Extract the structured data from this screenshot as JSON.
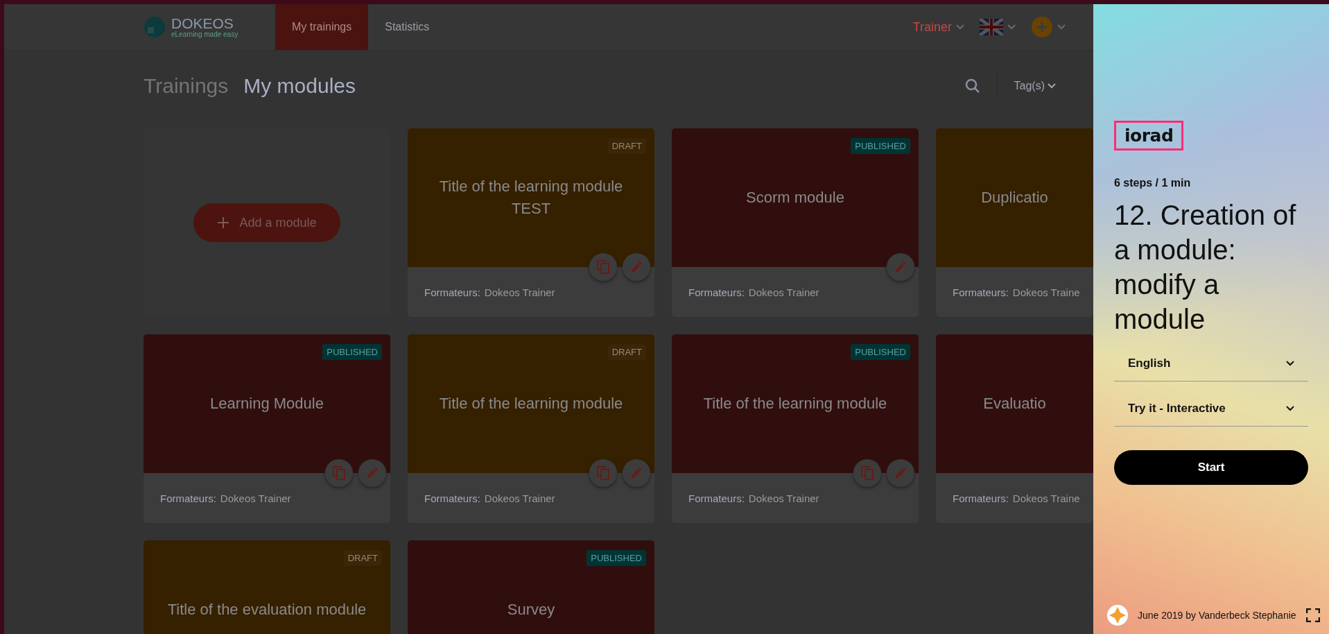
{
  "header": {
    "logo": {
      "name": "DOKEOS",
      "tagline": "eLearning made easy"
    },
    "nav": [
      {
        "label": "My trainings",
        "selected": true
      },
      {
        "label": "Statistics",
        "selected": false
      }
    ],
    "user": "Trainer"
  },
  "breadcrumb": [
    {
      "label": "Trainings",
      "selected": false
    },
    {
      "label": "My modules",
      "selected": true
    }
  ],
  "tag_filter": "Tag(s)",
  "add_module": "Add a module",
  "modules": [
    {
      "title": "Title of the learning module TEST",
      "kind": "draft",
      "badge": "DRAFT",
      "duplicable": true,
      "editable": true,
      "trainer_label": "Formateurs:",
      "trainer": "Dokeos Trainer"
    },
    {
      "title": "Scorm module",
      "kind": "published",
      "badge": "PUBLISHED",
      "duplicable": false,
      "editable": true,
      "trainer_label": "Formateurs:",
      "trainer": "Dokeos Trainer"
    },
    {
      "title": "Duplicatio",
      "kind": "draft",
      "trainer_label": "Formateurs:",
      "trainer": "Dokeos Traine"
    },
    {
      "title": "Learning Module",
      "kind": "published",
      "badge": "PUBLISHED",
      "duplicable": true,
      "editable": true,
      "trainer_label": "Formateurs:",
      "trainer": "Dokeos Trainer"
    },
    {
      "title": "Title of the learning module",
      "kind": "draft",
      "badge": "DRAFT",
      "duplicable": true,
      "editable": true,
      "trainer_label": "Formateurs:",
      "trainer": "Dokeos Trainer"
    },
    {
      "title": "Title of the learning module",
      "kind": "published",
      "badge": "PUBLISHED",
      "duplicable": true,
      "editable": true,
      "trainer_label": "Formateurs:",
      "trainer": "Dokeos Trainer"
    },
    {
      "title": "Evaluatio",
      "kind": "published",
      "trainer_label": "Formateurs:",
      "trainer": "Dokeos Traine"
    },
    {
      "title": "Title of the evaluation module",
      "kind": "draft",
      "badge": "DRAFT"
    },
    {
      "title": "Survey",
      "kind": "published",
      "badge": "PUBLISHED"
    }
  ],
  "panel": {
    "logo": "iorad",
    "meta": "6 steps / 1 min",
    "title": "12. Creation of a module: modify a module",
    "selects": [
      "English",
      "Try it - Interactive"
    ],
    "start": "Start",
    "credit": "June 2019 by Vanderbeck Stephanie"
  }
}
